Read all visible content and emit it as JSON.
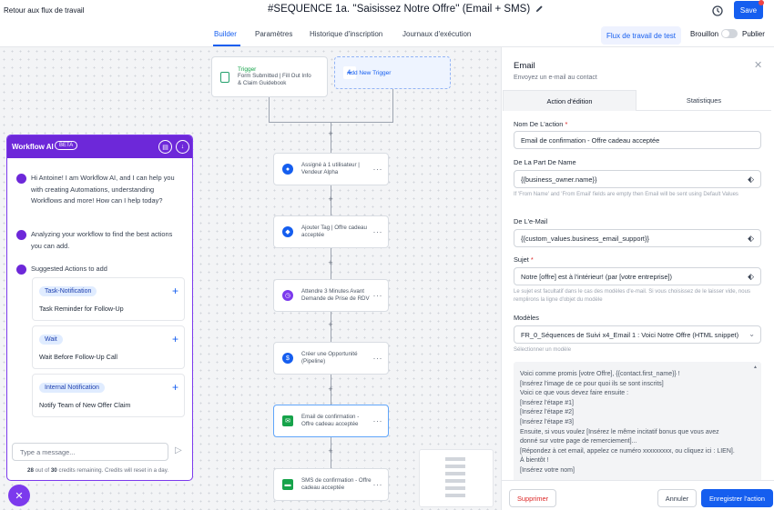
{
  "topbar": {
    "back_label": "Retour aux flux de travail",
    "title": "#SEQUENCE 1a. ''Saisissez Notre Offre'' (Email + SMS)",
    "save_label": "Save"
  },
  "tabs": {
    "items": [
      {
        "label": "Builder",
        "active": true
      },
      {
        "label": "Paramètres",
        "active": false
      },
      {
        "label": "Historique d'inscription",
        "active": false
      },
      {
        "label": "Journaux d'exécution",
        "active": false
      }
    ],
    "test_label": "Flux de travail de test",
    "draft_label": "Brouillon",
    "publish_label": "Publier",
    "published": false
  },
  "canvas": {
    "trigger": {
      "label": "Trigger",
      "line1": "Form Submitted | Fill Out Info",
      "line2": "& Claim Guidebook"
    },
    "add_trigger_label": "Add New Trigger",
    "plus_label": "+",
    "nodes": [
      {
        "line1": "Assigné à 1 utilisateur |",
        "line2": "Vendeur Alpha",
        "icon": "user-icon",
        "color": "#155eef"
      },
      {
        "line1": "Ajouter Tag | Offre cadeau",
        "line2": "acceptée",
        "icon": "tag-icon",
        "color": "#155eef"
      },
      {
        "line1": "Attendre 3 Minutes Avant",
        "line2": "Demande de Prise de RDV",
        "icon": "clock-icon",
        "color": "#7c3aed"
      },
      {
        "line1": "Créer une Opportunité",
        "line2": "(Pipeline)",
        "icon": "dollar-icon",
        "color": "#155eef"
      },
      {
        "line1": "Email de confirmation -",
        "line2": "Offre cadeau acceptée",
        "icon": "mail-icon",
        "color": "#16a34a"
      },
      {
        "line1": "SMS de confirmation - Offre",
        "line2": "cadeau acceptée",
        "icon": "sms-icon",
        "color": "#16a34a"
      }
    ]
  },
  "ai": {
    "title": "Workflow AI",
    "beta": "BETA",
    "intro": "Hi Antoine! I am Workflow AI, and I can help you with creating Automations, understanding Workflows and more! How can I help today?",
    "analyzing": "Analyzing your workflow to find the best actions you can add.",
    "suggested_title": "Suggested Actions to add",
    "suggestions": [
      {
        "badge": "Task-Notification",
        "desc": "Task Reminder for Follow-Up"
      },
      {
        "badge": "Wait",
        "desc": "Wait Before Follow-Up Call"
      },
      {
        "badge": "Internal Notification",
        "desc": "Notify Team of New Offer Claim"
      }
    ],
    "input_placeholder": "Type a message...",
    "credits_used": "28",
    "credits_total": "30",
    "credits_out_of": "out of",
    "credits_rest": "credits remaining. Credits will reset in a day."
  },
  "panel": {
    "title": "Email",
    "subtitle": "Envoyez un e-mail au contact",
    "tab_edit": "Action d'édition",
    "tab_stats": "Statistiques",
    "action_name_label": "Nom De L'action",
    "action_name_value": "Email de confirmation - Offre cadeau acceptée",
    "from_name_label": "De La Part De Name",
    "from_name_value": "{{business_owner.name}}",
    "from_name_hint": "If 'From Name' and 'From Email' fields are empty then Email will be sent using Default Values",
    "from_email_label": "De L'e-Mail",
    "from_email_value": "{{custom_values.business_email_support}}",
    "subject_label": "Sujet",
    "subject_value": "Notre [offre] est à l'intérieur! (par [votre entreprise])",
    "subject_hint": "Le sujet est facultatif dans le cas des modèles d'e-mail. Si vous choisissez de le laisser vide, nous remplirons la ligne d'objet du modèle",
    "templates_label": "Modèles",
    "template_value": "FR_0_Séquences de Suivi x4_Email 1 : Voici Notre Offre (HTML snippet)",
    "template_hint": "Sélectionner un modèle",
    "body_lines": [
      "Voici comme promis [votre Offre], {{contact.first_name}} !",
      "[Insérez l'image de ce pour quoi ils se sont inscrits]",
      "Voici ce que vous devez faire ensuite :",
      "[Insérez l'étape #1]",
      "[Insérez l'étape #2]",
      "[Insérez l'étape #3]",
      "Ensuite, si vous voulez [Insérez le même incitatif bonus que vous avez",
      "donné sur votre page de remerciement]...",
      "[Répondez à cet email, appelez ce numéro xxxxxxxxx, ou cliquez ici : LIEN].",
      "À bientôt !",
      "[Insérez votre nom]"
    ],
    "delete_label": "Supprimer",
    "cancel_label": "Annuler",
    "save_label": "Enregistrer l'action"
  }
}
